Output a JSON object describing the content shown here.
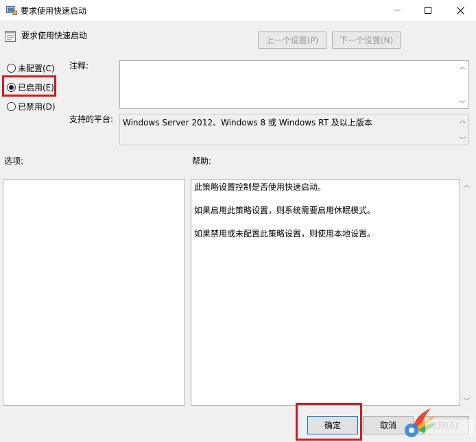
{
  "window": {
    "title": "要求使用快速启动"
  },
  "header": {
    "title": "要求使用快速启动",
    "prev_label": "上一个设置(P)",
    "next_label": "下一个设置(N)"
  },
  "state": {
    "options": [
      {
        "label": "未配置(C)",
        "checked": false
      },
      {
        "label": "已启用(E)",
        "checked": true
      },
      {
        "label": "已禁用(D)",
        "checked": false
      }
    ]
  },
  "comment": {
    "label": "注释:",
    "value": ""
  },
  "platform": {
    "label": "支持的平台:",
    "value": "Windows Server 2012、Windows 8 或 Windows RT 及以上版本"
  },
  "options_panel": {
    "label": "选项:"
  },
  "help": {
    "label": "帮助:",
    "paragraphs": [
      "此策略设置控制是否使用快速启动。",
      "如果启用此策略设置，则系统需要启用休眠模式。",
      "如果禁用或未配置此策略设置，则使用本地设置。"
    ]
  },
  "buttons": {
    "ok": "确定",
    "cancel": "取消",
    "apply": "应用(A)"
  },
  "colors": {
    "highlight": "#d11b1b",
    "dialog_bg": "#f0f0f0",
    "ok_border": "#0078d7"
  }
}
